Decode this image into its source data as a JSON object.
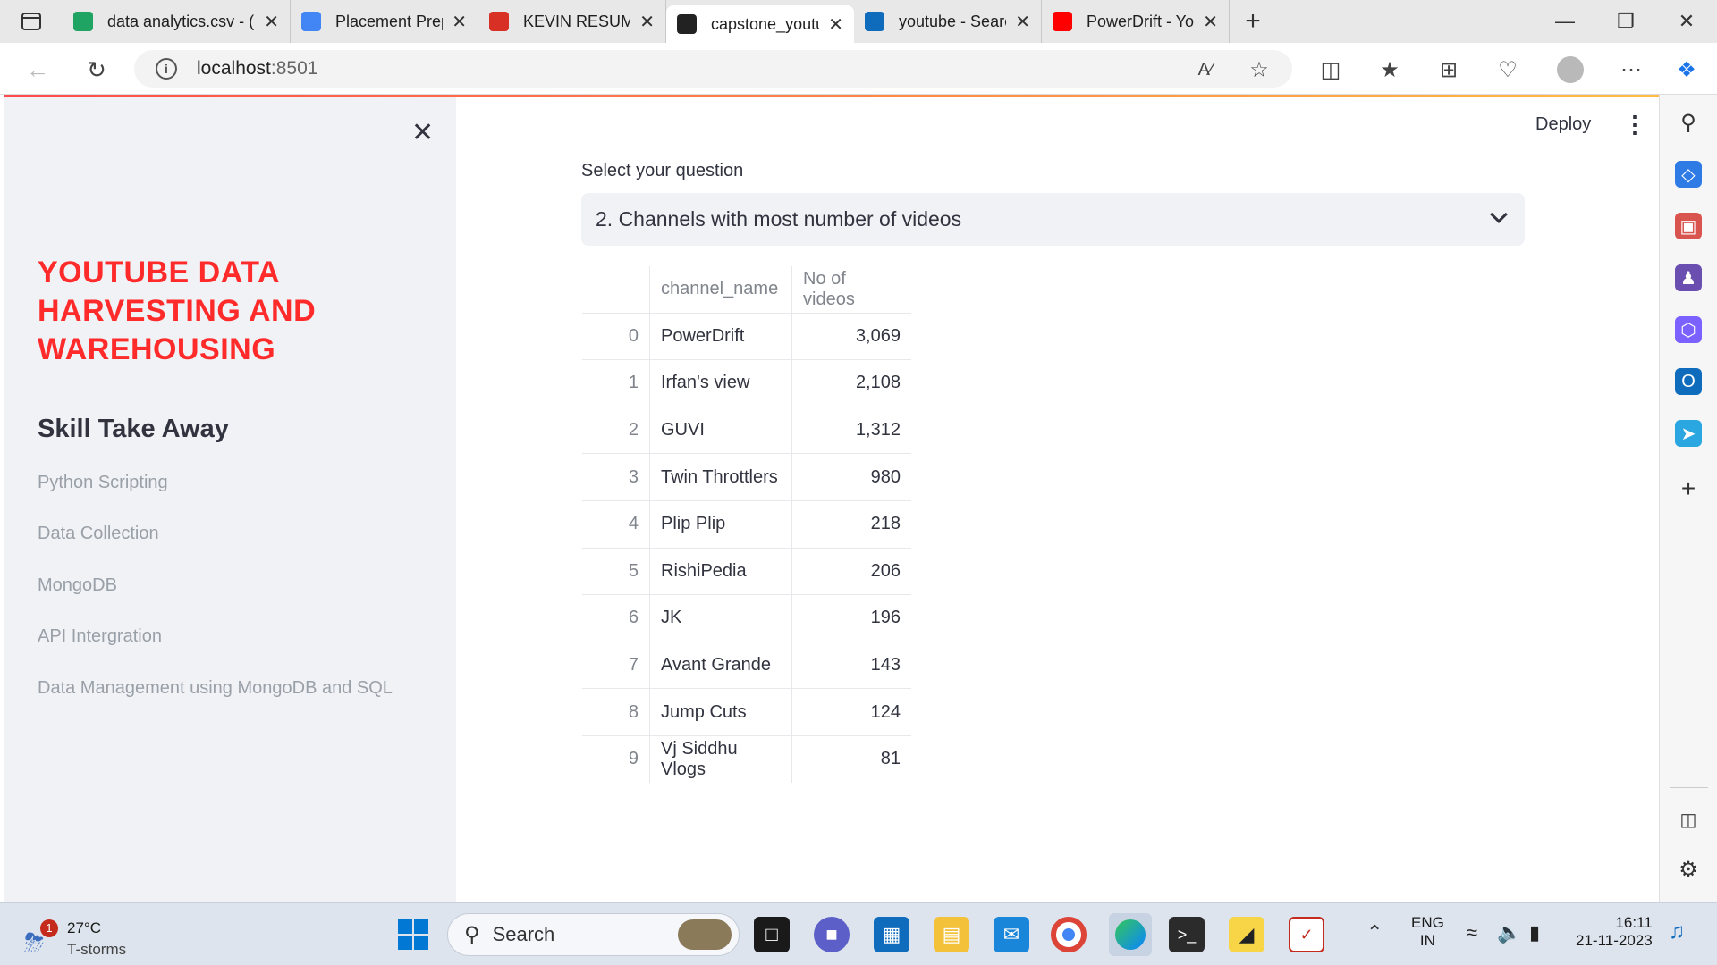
{
  "browser": {
    "tabs": [
      {
        "label": "data analytics.csv - (",
        "icon": "google-drive-icon",
        "color": "#1fa463"
      },
      {
        "label": "Placement Preparati",
        "icon": "google-docs-icon",
        "color": "#4285f4"
      },
      {
        "label": "KEVIN RESUME.pdf",
        "icon": "pdf-icon",
        "color": "#d93025"
      },
      {
        "label": "capstone_youtube",
        "icon": "streamlit-icon",
        "color": "#222"
      },
      {
        "label": "youtube - Search",
        "icon": "search-icon",
        "color": "#0f6cbd"
      },
      {
        "label": "PowerDrift - YouTub",
        "icon": "youtube-icon",
        "color": "#ff0000"
      }
    ],
    "url_host": "localhost",
    "url_port": ":8501"
  },
  "sidebar": {
    "title": "YOUTUBE DATA HARVESTING AND WAREHOUSING",
    "subtitle": "Skill Take Away",
    "skills": [
      "Python Scripting",
      "Data Collection",
      "MongoDB",
      "API Intergration",
      "Data Management using MongoDB and SQL"
    ]
  },
  "header": {
    "deploy_label": "Deploy"
  },
  "main": {
    "question_label": "Select your question",
    "selected_question": "2. Channels with most number of videos",
    "table": {
      "columns": [
        "channel_name",
        "No of videos"
      ],
      "rows": [
        {
          "index": "0",
          "channel_name": "PowerDrift",
          "videos": "3,069"
        },
        {
          "index": "1",
          "channel_name": "Irfan's view",
          "videos": "2,108"
        },
        {
          "index": "2",
          "channel_name": "GUVI",
          "videos": "1,312"
        },
        {
          "index": "3",
          "channel_name": "Twin Throttlers",
          "videos": "980"
        },
        {
          "index": "4",
          "channel_name": "Plip Plip",
          "videos": "218"
        },
        {
          "index": "5",
          "channel_name": "RishiPedia",
          "videos": "206"
        },
        {
          "index": "6",
          "channel_name": "JK",
          "videos": "196"
        },
        {
          "index": "7",
          "channel_name": "Avant Grande",
          "videos": "143"
        },
        {
          "index": "8",
          "channel_name": "Jump Cuts",
          "videos": "124"
        },
        {
          "index": "9",
          "channel_name": "Vj Siddhu Vlogs",
          "videos": "81"
        }
      ]
    }
  },
  "taskbar": {
    "weather_temp": "27°C",
    "weather_desc": "T-storms",
    "weather_badge": "1",
    "search_placeholder": "Search",
    "lang_line1": "ENG",
    "lang_line2": "IN",
    "time": "16:11",
    "date": "21-11-2023"
  }
}
